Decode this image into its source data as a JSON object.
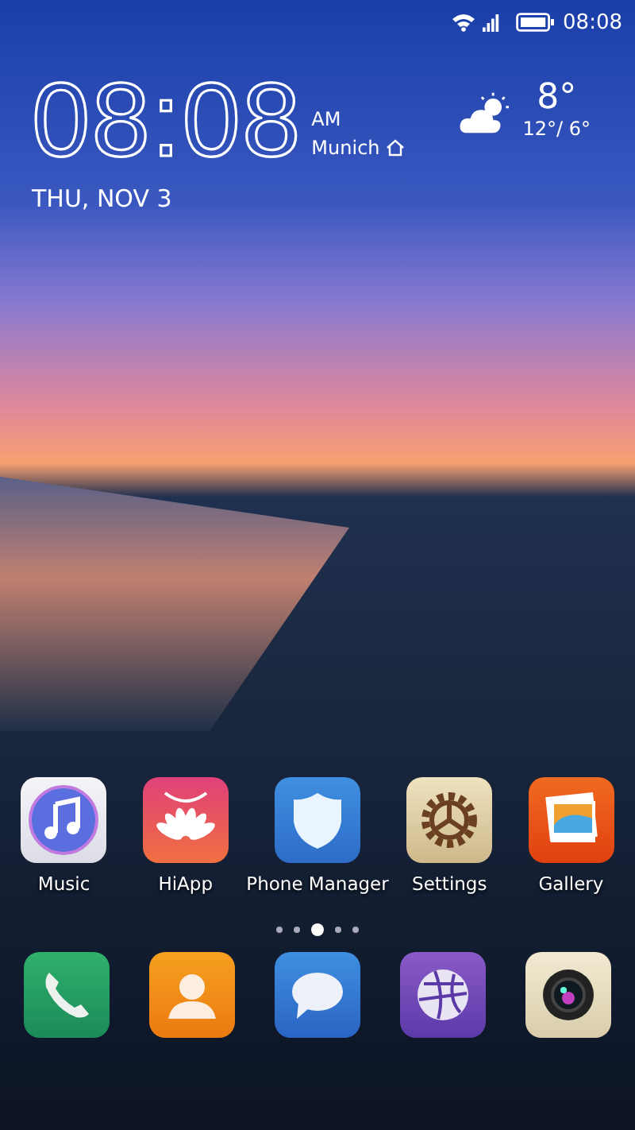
{
  "status_bar": {
    "time": "08:08"
  },
  "clock": {
    "time": "08:08",
    "meridiem": "AM",
    "city": "Munich",
    "date": "THU, NOV 3"
  },
  "weather": {
    "temperature": "8°",
    "range": "12°/ 6°"
  },
  "apps": [
    {
      "kind": "music",
      "label": "Music"
    },
    {
      "kind": "hiapp",
      "label": "HiApp"
    },
    {
      "kind": "shield",
      "label": "Phone Manager"
    },
    {
      "kind": "gear",
      "label": "Settings"
    },
    {
      "kind": "gallery",
      "label": "Gallery"
    }
  ],
  "page_dots": [
    {
      "selected": false
    },
    {
      "selected": false
    },
    {
      "selected": true
    },
    {
      "selected": false
    },
    {
      "selected": false
    }
  ],
  "dock": [
    {
      "kind": "phone"
    },
    {
      "kind": "contacts"
    },
    {
      "kind": "messages"
    },
    {
      "kind": "browser"
    },
    {
      "kind": "camera"
    }
  ]
}
